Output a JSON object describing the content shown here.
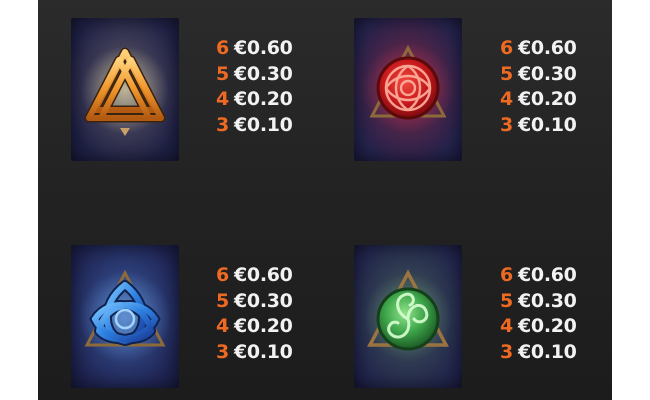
{
  "symbols": [
    {
      "name": "valknut",
      "icon": "valknut-icon",
      "payouts": [
        {
          "count": "6",
          "amount": "€0.60"
        },
        {
          "count": "5",
          "amount": "€0.30"
        },
        {
          "count": "4",
          "amount": "€0.20"
        },
        {
          "count": "3",
          "amount": "€0.10"
        }
      ]
    },
    {
      "name": "red-celtic-knot",
      "icon": "celtic-knot-circle-icon",
      "payouts": [
        {
          "count": "6",
          "amount": "€0.60"
        },
        {
          "count": "5",
          "amount": "€0.30"
        },
        {
          "count": "4",
          "amount": "€0.20"
        },
        {
          "count": "3",
          "amount": "€0.10"
        }
      ]
    },
    {
      "name": "blue-triquetra",
      "icon": "triquetra-icon",
      "payouts": [
        {
          "count": "6",
          "amount": "€0.60"
        },
        {
          "count": "5",
          "amount": "€0.30"
        },
        {
          "count": "4",
          "amount": "€0.20"
        },
        {
          "count": "3",
          "amount": "€0.10"
        }
      ]
    },
    {
      "name": "green-triskelion",
      "icon": "triskelion-icon",
      "payouts": [
        {
          "count": "6",
          "amount": "€0.60"
        },
        {
          "count": "5",
          "amount": "€0.30"
        },
        {
          "count": "4",
          "amount": "€0.20"
        },
        {
          "count": "3",
          "amount": "€0.10"
        }
      ]
    }
  ],
  "colors": {
    "count": "#ee6a22",
    "amount": "#f2f2f2",
    "panel": "#252525"
  }
}
